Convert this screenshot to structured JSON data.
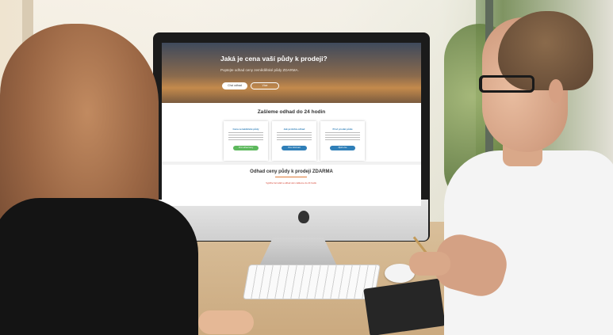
{
  "photo": {
    "subject": "",
    "website": {
      "hero_title": "Jaká je cena vaší půdy k prodeji?",
      "hero_subtitle": "Poptejte odhad ceny zemědělské půdy ZDARMA.",
      "hero_primary_button": "Chci odhad",
      "hero_secondary_button": "Více",
      "section1_title": "Zašleme odhad do 24 hodin",
      "cards": [
        {
          "title": "Cena zemědělské půdy",
          "button": "Chci odhad ceny",
          "button_color": "#5cb85c"
        },
        {
          "title": "Jak probíhá odhad",
          "button": "Více informací",
          "button_color": "#2f7fb8"
        },
        {
          "title": "Proč prodat půdu",
          "button": "Zjistit více",
          "button_color": "#2f7fb8"
        }
      ],
      "section2_title": "Odhad ceny půdy k prodeji ZDARMA",
      "note": "Vyplňte formulář a odhad vám zašleme do 24 hodin."
    }
  }
}
